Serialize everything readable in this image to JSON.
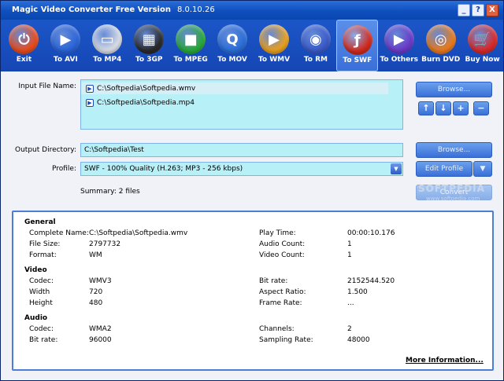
{
  "window": {
    "title": "Magic Video Converter Free Version",
    "version": "8.0.10.26",
    "controls": {
      "minimize": "_",
      "help": "?",
      "close": "X"
    }
  },
  "toolbar": {
    "items": [
      {
        "label": "Exit",
        "icon": "power-icon",
        "color": "#e84c1c",
        "glyph": "⏻"
      },
      {
        "label": "To AVI",
        "icon": "play-icon",
        "color": "#2a64d8",
        "glyph": "▶"
      },
      {
        "label": "To MP4",
        "icon": "ipod-icon",
        "color": "#d8dce4",
        "glyph": "▭"
      },
      {
        "label": "To 3GP",
        "icon": "phone-icon",
        "color": "#2a2a2a",
        "glyph": "▦"
      },
      {
        "label": "To MPEG",
        "icon": "camera-icon",
        "color": "#2aa83a",
        "glyph": "■"
      },
      {
        "label": "To MOV",
        "icon": "quicktime-icon",
        "color": "#2a6ed8",
        "glyph": "Q"
      },
      {
        "label": "To WMV",
        "icon": "wmv-icon",
        "color": "#e8a020",
        "glyph": "▶"
      },
      {
        "label": "To RM",
        "icon": "realmedia-icon",
        "color": "#3a5ac8",
        "glyph": "◉"
      },
      {
        "label": "To SWF",
        "icon": "flash-icon",
        "color": "#d02a1c",
        "glyph": "ƒ"
      },
      {
        "label": "To Others",
        "icon": "others-play-icon",
        "color": "#6a3ac8",
        "glyph": "▶"
      },
      {
        "label": "Burn DVD",
        "icon": "dvd-icon",
        "color": "#e87a1c",
        "glyph": "◎"
      },
      {
        "label": "Buy Now",
        "icon": "cart-icon",
        "color": "#d82a2a",
        "glyph": "🛒"
      }
    ],
    "active_index": 8
  },
  "input": {
    "label": "Input File Name:",
    "files": [
      "C:\\Softpedia\\Softpedia.wmv",
      "C:\\Softpedia\\Softpedia.mp4"
    ],
    "browse_label": "Browse..."
  },
  "list_controls": {
    "up": "↑",
    "down": "↓",
    "add": "+",
    "remove": "−"
  },
  "output": {
    "label": "Output Directory:",
    "value": "C:\\Softpedia\\Test",
    "browse_label": "Browse..."
  },
  "profile": {
    "label": "Profile:",
    "value": "SWF - 100% Quality (H.263; MP3 - 256 kbps)",
    "edit_label": "Edit Profile"
  },
  "summary": "Summary: 2 files",
  "convert_label": "Convert",
  "watermark": {
    "main": "SOFTPEDIA",
    "sub": "www.softpedia.com"
  },
  "info": {
    "general": {
      "heading": "General",
      "complete_name_label": "Complete Name:",
      "complete_name": "C:\\Softpedia\\Softpedia.wmv",
      "file_size_label": "File Size:",
      "file_size": "2797732",
      "format_label": "Format:",
      "format": "WM",
      "play_time_label": "Play Time:",
      "play_time": "00:00:10.176",
      "audio_count_label": "Audio Count:",
      "audio_count": "1",
      "video_count_label": "Video Count:",
      "video_count": "1"
    },
    "video": {
      "heading": "Video",
      "codec_label": "Codec:",
      "codec": "WMV3",
      "width_label": "Width",
      "width": "720",
      "height_label": "Height",
      "height": "480",
      "bitrate_label": "Bit rate:",
      "bitrate": "2152544.520",
      "aspect_label": "Aspect Ratio:",
      "aspect": "1.500",
      "framerate_label": "Frame Rate:",
      "framerate": "..."
    },
    "audio": {
      "heading": "Audio",
      "codec_label": "Codec:",
      "codec": "WMA2",
      "bitrate_label": "Bit rate:",
      "bitrate": "96000",
      "channels_label": "Channels:",
      "channels": "2",
      "sampling_label": "Sampling Rate:",
      "sampling": "48000"
    },
    "more_label": "More Information..."
  }
}
